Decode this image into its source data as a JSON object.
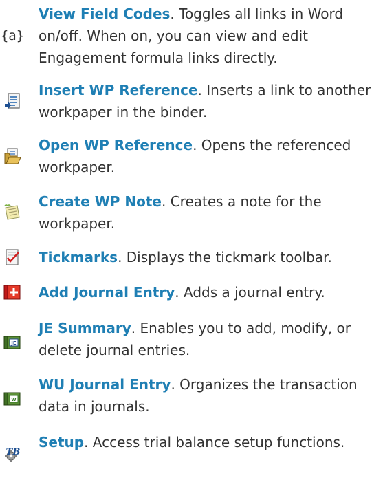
{
  "items": [
    {
      "icon": "field-codes-icon",
      "title": "View Field Codes",
      "description": ". Toggles all links in Word on/off. When on, you can view and edit Engagement formula links directly."
    },
    {
      "icon": "insert-wp-reference-icon",
      "title": "Insert WP Reference",
      "description": ". Inserts a link to another workpaper in the binder."
    },
    {
      "icon": "open-wp-reference-icon",
      "title": "Open WP Reference",
      "description": ". Opens the referenced workpaper."
    },
    {
      "icon": "wp-note-icon",
      "title": "Create WP Note",
      "description": ". Creates a note for the workpaper."
    },
    {
      "icon": "tickmarks-icon",
      "title": "Tickmarks",
      "description": ". Displays the tickmark toolbar."
    },
    {
      "icon": "add-journal-entry-icon",
      "title": "Add Journal Entry",
      "description": ". Adds a journal entry."
    },
    {
      "icon": "je-summary-icon",
      "title": "JE Summary",
      "description": ". Enables you to add, modify, or delete journal entries."
    },
    {
      "icon": "wu-journal-entry-icon",
      "title": "WU Journal Entry",
      "description": ". Organizes the transaction data in journals."
    },
    {
      "icon": "tb-setup-icon",
      "title": "Setup",
      "description": ". Access trial balance setup functions."
    }
  ]
}
